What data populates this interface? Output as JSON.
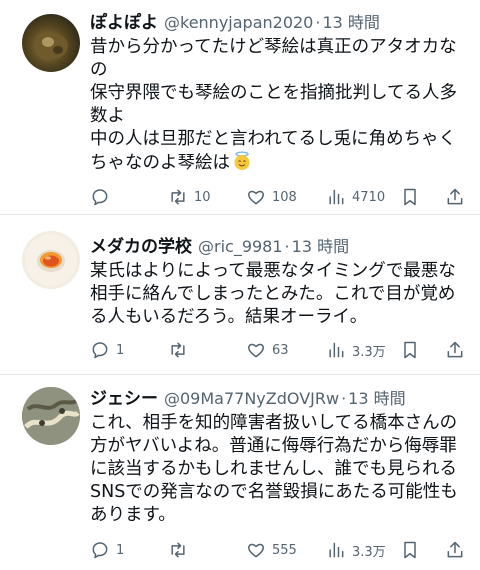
{
  "tweets": [
    {
      "name": "ぽよぽよ",
      "handle": "@kennyjapan2020",
      "separator": "·",
      "time": "13 時間",
      "lines": [
        "昔から分かってたけど琴絵は真正のアタオカな",
        "の",
        "保守界隈でも琴絵のことを指摘批判してる人多",
        "数よ",
        "中の人は旦那だと言われてるし兎に角めちゃく",
        "ちゃなのよ琴絵は"
      ],
      "emoji": "smiling-face-with-halo-emoji",
      "reply_count": "",
      "retweet_count": "10",
      "like_count": "108",
      "view_count": "4710",
      "avatar_color": "#6b5a2e"
    },
    {
      "name": "メダカの学校",
      "handle": "@ric_9981",
      "separator": "·",
      "time": "13 時間",
      "lines": [
        "某氏はよりによって最悪なタイミングで最悪な",
        "相手に絡んでしまったとみた。これで目が覚め",
        "る人もいるだろう。結果オーライ。"
      ],
      "reply_count": "1",
      "retweet_count": "",
      "like_count": "63",
      "view_count": "3.3万",
      "avatar_color": "#f0e6d8"
    },
    {
      "name": "ジェシー",
      "handle": "@09Ma77NyZdOVJRw",
      "separator": "·",
      "time": "13 時間",
      "lines": [
        "これ、相手を知的障害者扱いしてる橋本さんの",
        "方がヤバいよね。普通に侮辱行為だから侮辱罪",
        "に該当するかもしれませんし、誰でも見られる",
        "SNSでの発言なので名誉毀損にあたる可能性も",
        "あります。"
      ],
      "reply_count": "1",
      "retweet_count": "",
      "like_count": "555",
      "view_count": "3.3万",
      "avatar_color": "#8a8f7a"
    }
  ],
  "colors": {
    "text_primary": "#0f1419",
    "text_secondary": "#536471",
    "divider": "#e6e9eb"
  }
}
